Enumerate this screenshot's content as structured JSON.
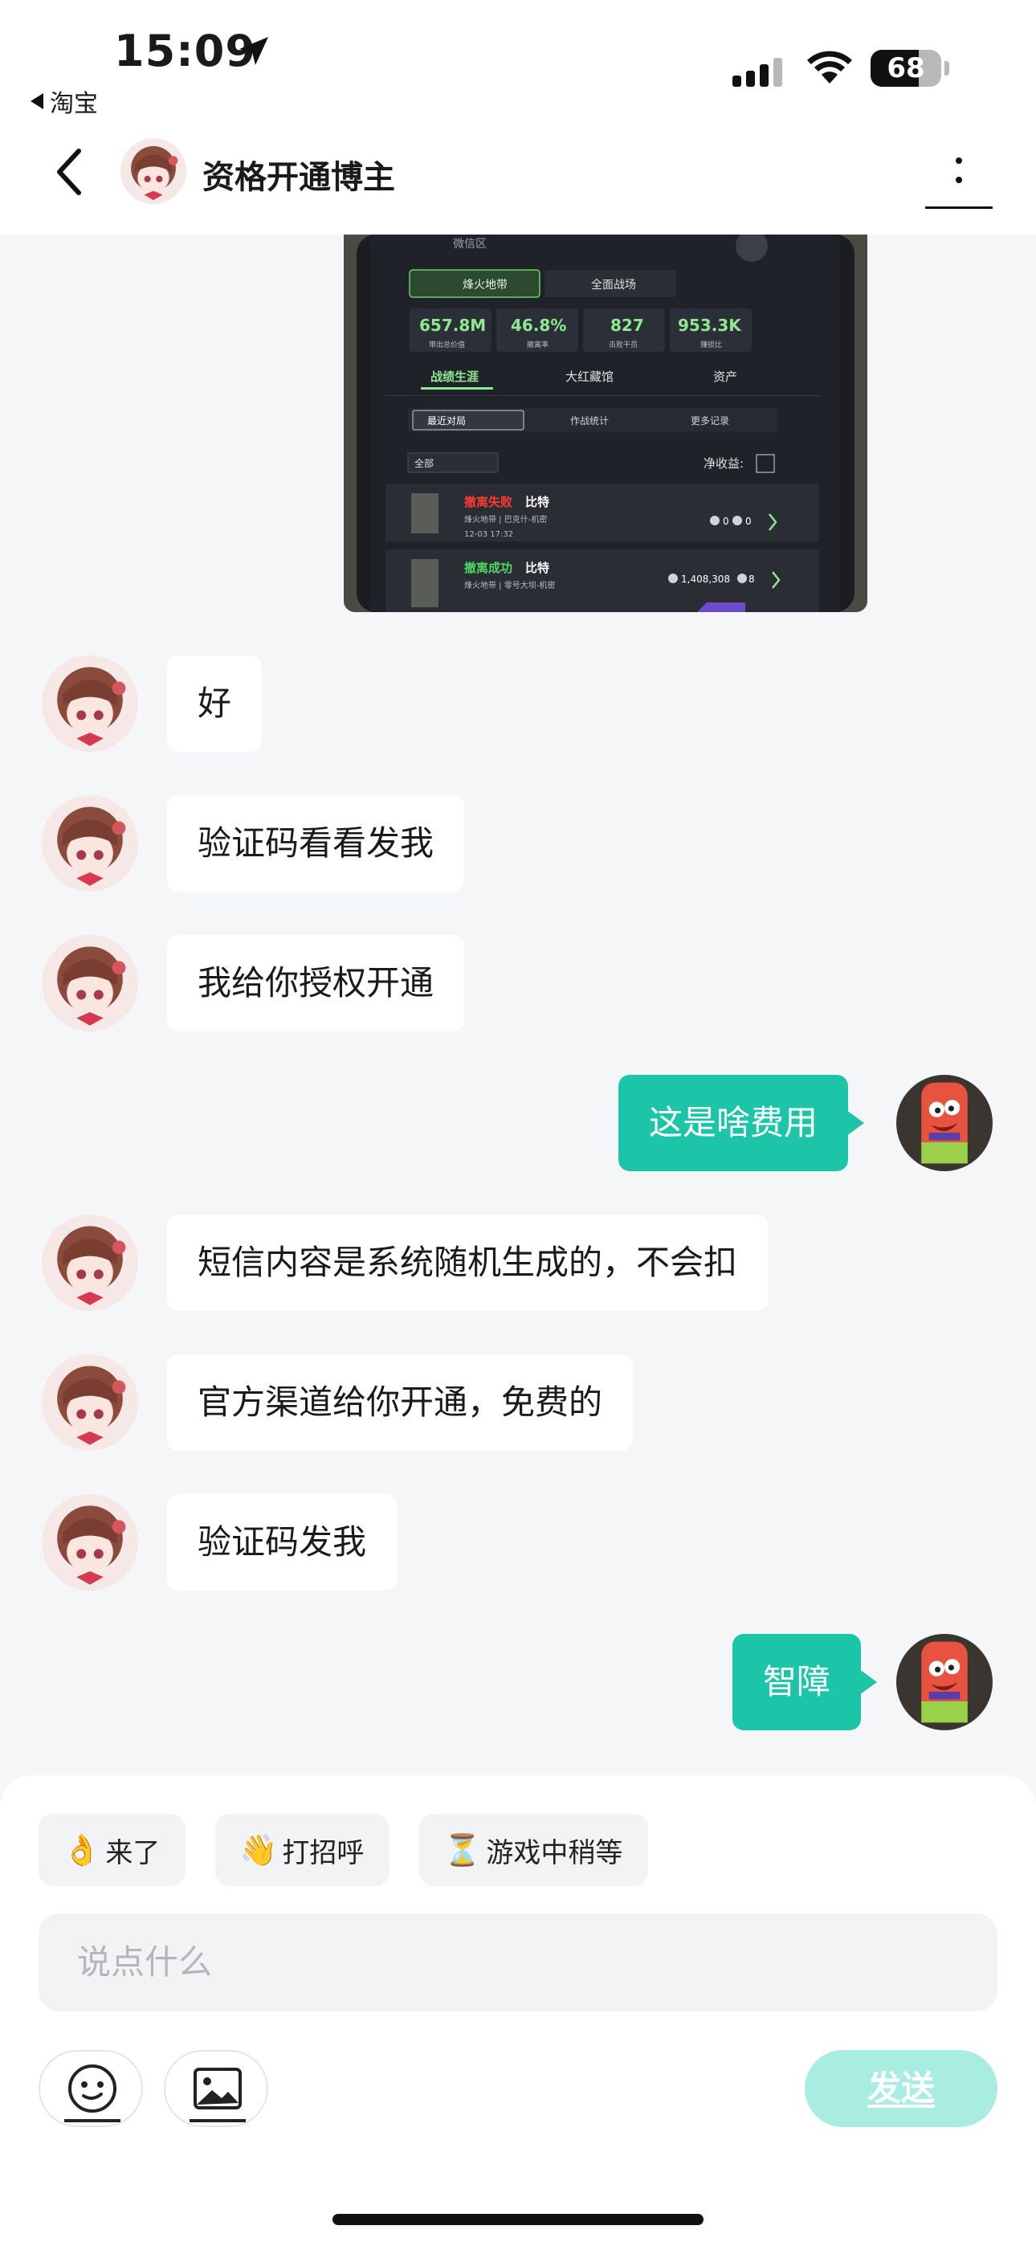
{
  "status_bar": {
    "time": "15:09",
    "back_app": "淘宝",
    "battery": "68",
    "battery_level": 0.68
  },
  "header": {
    "title": "资格开通博主"
  },
  "game_screenshot": {
    "zone": "微信区",
    "tab_left": "烽火地带",
    "tab_right": "全面战场",
    "stats": [
      {
        "value": "657.8M",
        "label": "带出总价值"
      },
      {
        "value": "46.8%",
        "label": "撤离率"
      },
      {
        "value": "827",
        "label": "击败干员"
      },
      {
        "value": "953.3K",
        "label": "赚损比"
      }
    ],
    "nav": [
      "战绩生涯",
      "大红藏馆",
      "资产"
    ],
    "subtabs": [
      "最近对局",
      "作战统计",
      "更多记录"
    ],
    "filter": "全部",
    "net_label": "净收益:",
    "matches": [
      {
        "result": "撤离失败",
        "name": "比特",
        "map": "烽火地带 | 巴克什-机密",
        "time": "12-03 17:32",
        "value": "0",
        "kills": "0",
        "result_color": "#ff3b30"
      },
      {
        "result": "撤离成功",
        "name": "比特",
        "map": "烽火地带 | 零号大坝-机密",
        "time": "",
        "value": "1,408,308",
        "kills": "8",
        "result_color": "#4cd964"
      }
    ]
  },
  "messages": [
    {
      "side": "in",
      "text": "好"
    },
    {
      "side": "in",
      "text": "验证码看看发我"
    },
    {
      "side": "in",
      "text": "我给你授权开通"
    },
    {
      "side": "out",
      "text": "这是啥费用"
    },
    {
      "side": "in",
      "text": "短信内容是系统随机生成的，不会扣"
    },
    {
      "side": "in",
      "text": "官方渠道给你开通，免费的"
    },
    {
      "side": "in",
      "text": "验证码发我"
    },
    {
      "side": "out",
      "text": "智障"
    }
  ],
  "composer": {
    "quick_replies": [
      {
        "emoji": "👌",
        "label": "来了"
      },
      {
        "emoji": "👋",
        "label": "打招呼"
      },
      {
        "emoji": "⏳",
        "label": "游戏中稍等"
      }
    ],
    "placeholder": "说点什么",
    "send_label": "发送"
  },
  "colors": {
    "accent": "#1cc5a8",
    "send_disabled": "#a9ece0",
    "background": "#f5f6f8"
  }
}
